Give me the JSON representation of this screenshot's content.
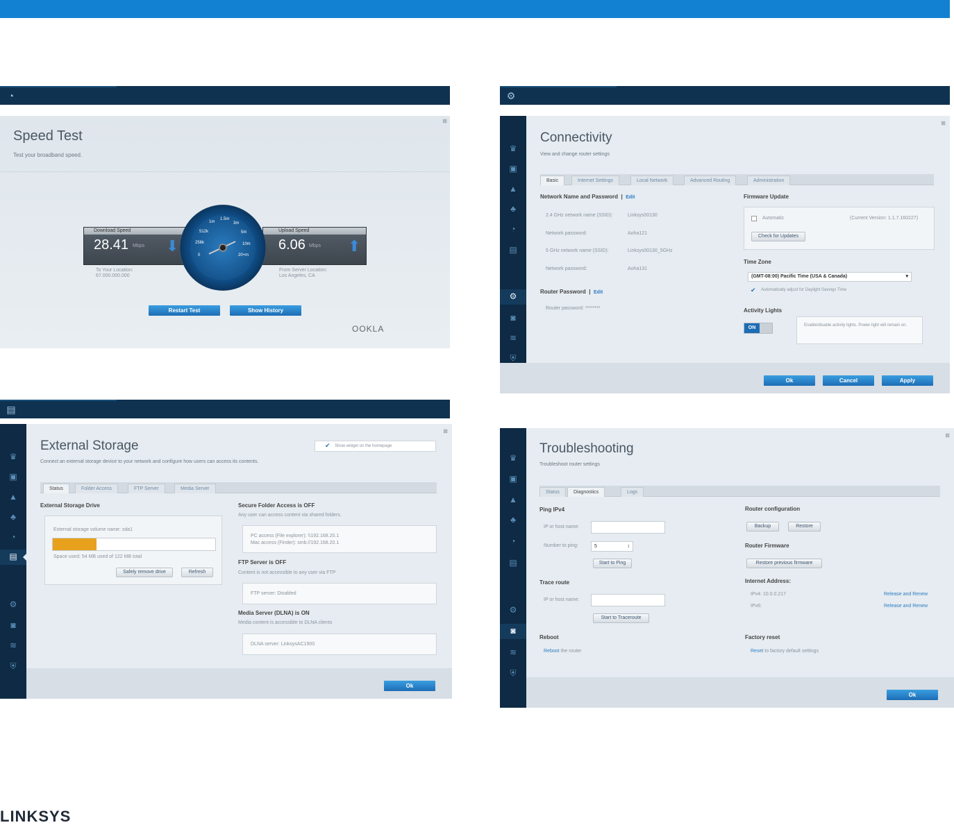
{
  "brand": {
    "logo": "LINKSYS"
  },
  "speed": {
    "title": "Speed Test",
    "subtitle": "Test your broadband speed.",
    "download_label": "Download Speed",
    "download_value": "28.41",
    "download_unit": "Mbps",
    "download_loc1": "To Your Location:",
    "download_loc2": "67.000.000.000",
    "upload_label": "Upload Speed",
    "upload_value": "6.06",
    "upload_unit": "Mbps",
    "upload_loc1": "From Server Location:",
    "upload_loc2": "Los Angeles, CA",
    "gauge_ticks": [
      "1m",
      "1.5m",
      "3m",
      "512k",
      "5m",
      "256k",
      "10m",
      "0",
      "20+m"
    ],
    "restart": "Restart Test",
    "history": "Show History",
    "ookla": "OOKLA"
  },
  "conn": {
    "title": "Connectivity",
    "subtitle": "View and change router settings",
    "tabs": [
      "Basic",
      "Internet Settings",
      "Local Network",
      "Advanced Routing",
      "Administration"
    ],
    "nnp": "Network Name and Password",
    "edit": "Edit",
    "f1l": "2.4 GHz network name (SSID):",
    "f1v": "Linksys00130",
    "f2l": "Network password:",
    "f2v": "Aoha121",
    "f3l": "5 GHz network name (SSID):",
    "f3v": "Linksys00130_5GHz",
    "f4l": "Network password:",
    "f4v": "Aoha131",
    "rp": "Router Password",
    "rpl": "Router password:",
    "rpv": "********",
    "fw": "Firmware Update",
    "auto": "Automatic",
    "ver": "(Current Version: 1.1.7.160227)",
    "check": "Check for Updates",
    "tz": "Time Zone",
    "tzv": "(GMT-08:00) Pacific Time (USA & Canada)",
    "dst": "Automatically adjust for Daylight Savings Time",
    "al": "Activity Lights",
    "on": "ON",
    "ald": "Enable/disable activity lights. Power light will remain on.",
    "ok": "Ok",
    "cancel": "Cancel",
    "apply": "Apply"
  },
  "ext": {
    "title": "External Storage",
    "subtitle": "Connect an external storage device to your network and configure how users can access its contents.",
    "show": "Show widget on the homepage",
    "tabs": [
      "Status",
      "Folder Access",
      "FTP Server",
      "Media Server"
    ],
    "drive": "External Storage Drive",
    "vol": "External storage volume name: sda1",
    "usage_fraction": 0.27,
    "used": "Space used: 54 MB used of 122 MB total",
    "safe": "Safely remove drive",
    "refresh": "Refresh",
    "sfa": "Secure Folder Access is OFF",
    "sfad": "Any user can access content via shared folders.",
    "pc": "PC access (File explorer): \\\\192.168.20.1",
    "mac": "Mac access (Finder): smb://192.168.20.1",
    "ftp": "FTP Server is OFF",
    "ftpd": "Content is not accessible to any user via FTP",
    "ftps": "FTP server: Disabled",
    "ms": "Media Server (DLNA) is ON",
    "msd": "Media content is accessible to DLNA clients",
    "dlna": "DLNA server: LinksysAC1900",
    "ok": "Ok"
  },
  "trb": {
    "title": "Troubleshooting",
    "subtitle": "Troubleshoot router settings",
    "tabs": [
      "Status",
      "Diagnostics",
      "Logs"
    ],
    "ping": "Ping IPv4",
    "host": "IP or host name:",
    "num": "Number to ping:",
    "numv": "5",
    "startping": "Start to Ping",
    "trace": "Trace route",
    "host2": "IP or host name:",
    "starttrace": "Start to Traceroute",
    "reboot": "Reboot",
    "rebootl": "Reboot",
    "rebootr": "the router",
    "rc": "Router configuration",
    "backup": "Backup",
    "restore": "Restore",
    "rf": "Router Firmware",
    "restorefw": "Restore previous firmware",
    "ia": "Internet Address:",
    "ipv4": "IPv4: 10.0.0.217",
    "ipv6": "IPv6:",
    "rr1": "Release and Renew",
    "rr2": "Release and Renew",
    "fr": "Factory reset",
    "frl": "Reset",
    "frr": "to factory default settings",
    "ok": "Ok"
  }
}
